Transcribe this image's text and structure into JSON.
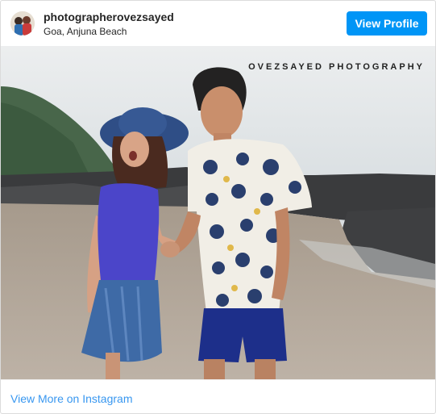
{
  "post": {
    "username": "photographerovezsayed",
    "location": "Goa, Anjuna Beach",
    "view_profile_label": "View Profile",
    "watermark": "OVEZSAYED PHOTOGRAPHY",
    "view_more_label": "View More on Instagram"
  },
  "colors": {
    "accent": "#0095f6",
    "link": "#3897f0"
  }
}
